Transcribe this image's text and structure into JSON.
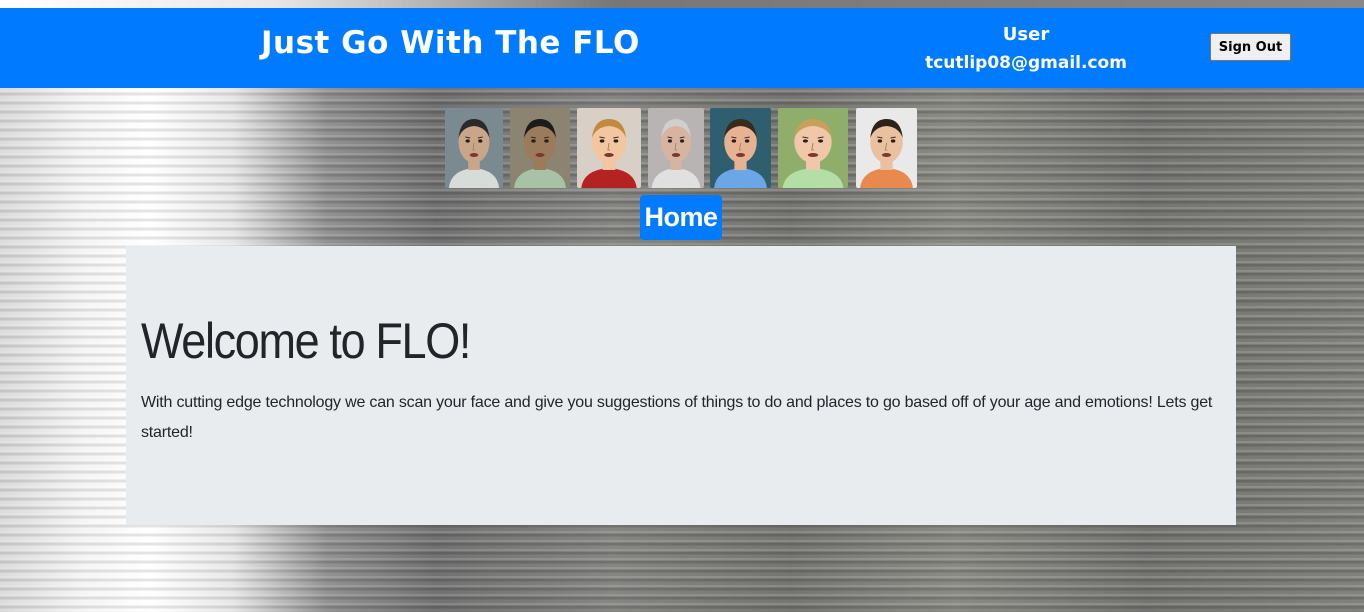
{
  "header": {
    "title": "Just Go With The FLO",
    "user_label": "User",
    "user_email": "tcutlip08@gmail.com",
    "signout_label": "Sign Out"
  },
  "faces": [
    {
      "name": "angry-face-photo",
      "skin": "#c9a58a",
      "bg": "#7a8a90",
      "shirt": "#d8dcd8",
      "hair": "#2a2a2a"
    },
    {
      "name": "selfie-face-photo",
      "skin": "#9c7a5c",
      "bg": "#8b8470",
      "shirt": "#a7c2a4",
      "hair": "#1c1c1c"
    },
    {
      "name": "shocked-kid-photo",
      "skin": "#f1c6a0",
      "bg": "#d8d0c6",
      "shirt": "#b42222",
      "hair": "#c08a40"
    },
    {
      "name": "frowning-bald-man-photo",
      "skin": "#d6b4a0",
      "bg": "#b8b4b4",
      "shirt": "#e0e0e0",
      "hair": "#cfcfcf"
    },
    {
      "name": "smiling-man-photo",
      "skin": "#e6b291",
      "bg": "#2f5f6f",
      "shirt": "#6ba7e6",
      "hair": "#3a2a1a"
    },
    {
      "name": "sad-girl-photo",
      "skin": "#f0c7a8",
      "bg": "#8fae6c",
      "shirt": "#b4dfa4",
      "hair": "#c7a05c"
    },
    {
      "name": "surprised-man-photo",
      "skin": "#e9c0a0",
      "bg": "#e9e9e9",
      "shirt": "#e88a50",
      "hair": "#2d2218"
    }
  ],
  "nav": {
    "home_label": "Home"
  },
  "main": {
    "title": "Welcome to FLO!",
    "text": "With cutting edge technology we can scan your face and give you suggestions of things to do and places to go based off of your age and emotions! Lets get started!"
  },
  "colors": {
    "brand": "#007bff",
    "jumbotron": "#e9ecef",
    "text": "#212529"
  }
}
